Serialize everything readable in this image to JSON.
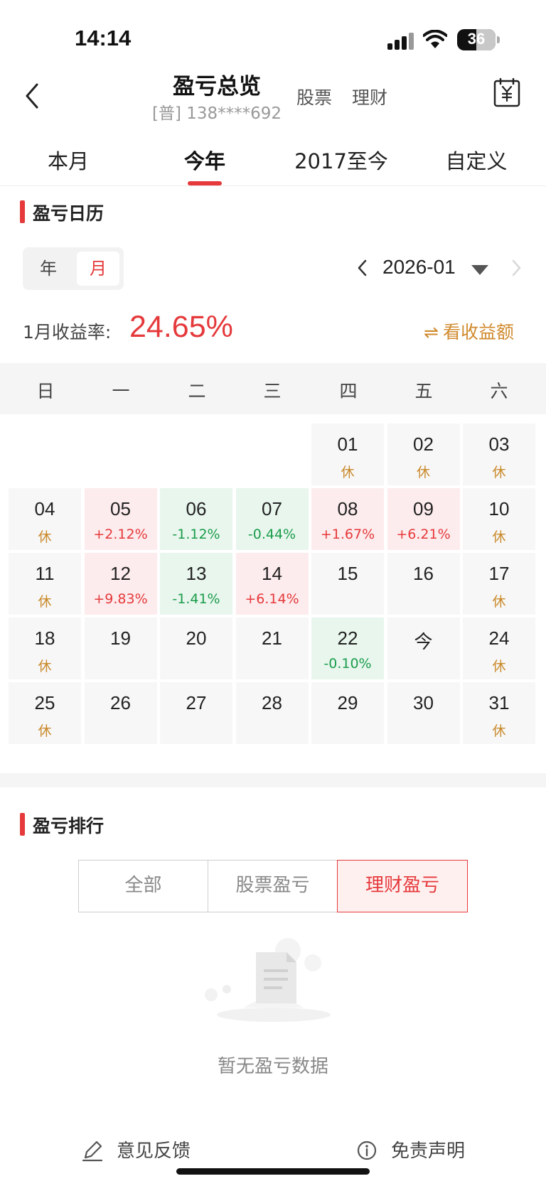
{
  "status_bar": {
    "time": "14:14",
    "battery": "36"
  },
  "header": {
    "title": "盈亏总览",
    "account": "[普] 138****692",
    "links": [
      "股票",
      "理财"
    ]
  },
  "tabs": [
    {
      "label": "本月",
      "active": false
    },
    {
      "label": "今年",
      "active": true
    },
    {
      "label": "2017至今",
      "active": false
    },
    {
      "label": "自定义",
      "active": false
    }
  ],
  "calendar_section": {
    "title": "盈亏日历",
    "toggle": {
      "year": "年",
      "month": "月",
      "selected": "月"
    },
    "current_month": "2026-01",
    "rate_label": "1月收益率:",
    "rate_value": "24.65%",
    "view_amount_icon": "⇌",
    "view_amount": "看收益额",
    "weekdays": [
      "日",
      "一",
      "二",
      "三",
      "四",
      "五",
      "六"
    ],
    "days": [
      {
        "day": "01",
        "sub": "休",
        "kind": "rest",
        "col": 4,
        "row": 0
      },
      {
        "day": "02",
        "sub": "休",
        "kind": "rest",
        "col": 5,
        "row": 0
      },
      {
        "day": "03",
        "sub": "休",
        "kind": "rest",
        "col": 6,
        "row": 0
      },
      {
        "day": "04",
        "sub": "休",
        "kind": "rest",
        "col": 0,
        "row": 1
      },
      {
        "day": "05",
        "sub": "+2.12%",
        "kind": "up",
        "col": 1,
        "row": 1
      },
      {
        "day": "06",
        "sub": "-1.12%",
        "kind": "down",
        "col": 2,
        "row": 1
      },
      {
        "day": "07",
        "sub": "-0.44%",
        "kind": "down",
        "col": 3,
        "row": 1
      },
      {
        "day": "08",
        "sub": "+1.67%",
        "kind": "up",
        "col": 4,
        "row": 1
      },
      {
        "day": "09",
        "sub": "+6.21%",
        "kind": "up",
        "col": 5,
        "row": 1
      },
      {
        "day": "10",
        "sub": "休",
        "kind": "rest",
        "col": 6,
        "row": 1
      },
      {
        "day": "11",
        "sub": "休",
        "kind": "rest",
        "col": 0,
        "row": 2
      },
      {
        "day": "12",
        "sub": "+9.83%",
        "kind": "up",
        "col": 1,
        "row": 2
      },
      {
        "day": "13",
        "sub": "-1.41%",
        "kind": "down",
        "col": 2,
        "row": 2
      },
      {
        "day": "14",
        "sub": "+6.14%",
        "kind": "up",
        "col": 3,
        "row": 2
      },
      {
        "day": "15",
        "sub": "",
        "kind": "none",
        "col": 4,
        "row": 2
      },
      {
        "day": "16",
        "sub": "",
        "kind": "none",
        "col": 5,
        "row": 2
      },
      {
        "day": "17",
        "sub": "休",
        "kind": "rest",
        "col": 6,
        "row": 2
      },
      {
        "day": "18",
        "sub": "休",
        "kind": "rest",
        "col": 0,
        "row": 3
      },
      {
        "day": "19",
        "sub": "",
        "kind": "none",
        "col": 1,
        "row": 3
      },
      {
        "day": "20",
        "sub": "",
        "kind": "none",
        "col": 2,
        "row": 3
      },
      {
        "day": "21",
        "sub": "",
        "kind": "none",
        "col": 3,
        "row": 3
      },
      {
        "day": "22",
        "sub": "-0.10%",
        "kind": "down",
        "col": 4,
        "row": 3
      },
      {
        "day": "今",
        "sub": "",
        "kind": "none",
        "col": 5,
        "row": 3
      },
      {
        "day": "24",
        "sub": "休",
        "kind": "rest",
        "col": 6,
        "row": 3
      },
      {
        "day": "25",
        "sub": "休",
        "kind": "rest",
        "col": 0,
        "row": 4
      },
      {
        "day": "26",
        "sub": "",
        "kind": "none",
        "col": 1,
        "row": 4
      },
      {
        "day": "27",
        "sub": "",
        "kind": "none",
        "col": 2,
        "row": 4
      },
      {
        "day": "28",
        "sub": "",
        "kind": "none",
        "col": 3,
        "row": 4
      },
      {
        "day": "29",
        "sub": "",
        "kind": "none",
        "col": 4,
        "row": 4
      },
      {
        "day": "30",
        "sub": "",
        "kind": "none",
        "col": 5,
        "row": 4
      },
      {
        "day": "31",
        "sub": "休",
        "kind": "rest",
        "col": 6,
        "row": 4
      }
    ]
  },
  "ranking_section": {
    "title": "盈亏排行",
    "segments": [
      {
        "label": "全部",
        "active": false
      },
      {
        "label": "股票盈亏",
        "active": false
      },
      {
        "label": "理财盈亏",
        "active": true
      }
    ],
    "empty_text": "暂无盈亏数据"
  },
  "footer": {
    "feedback": "意见反馈",
    "disclaimer": "免责声明"
  },
  "colors": {
    "accent_red": "#e5393b",
    "loss_green": "#1b9c4a",
    "rest_gold": "#c98a2c"
  }
}
